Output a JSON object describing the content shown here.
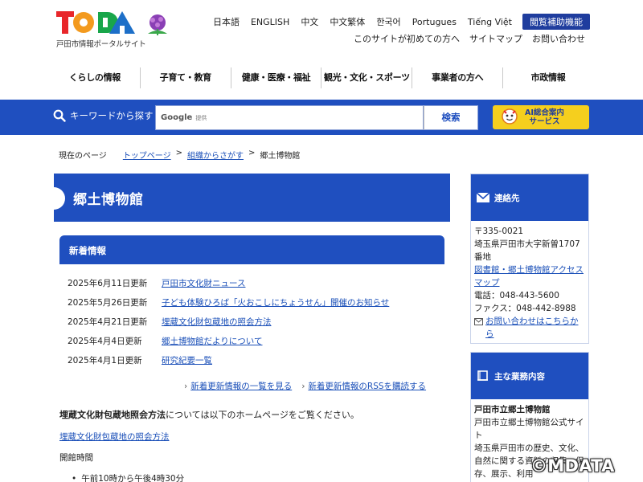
{
  "header": {
    "logo_text": "TODA",
    "logo_subtitle": "戸田市情報ポータルサイト",
    "languages": [
      "日本語",
      "ENGLISH",
      "中文",
      "中文繁体",
      "한국어",
      "Portugues",
      "Tiếng Việt"
    ],
    "assist_button": "閲覧補助機能",
    "util_links": [
      "このサイトが初めての方へ",
      "サイトマップ",
      "お問い合わせ"
    ],
    "global_nav": [
      "くらしの情報",
      "子育て・教育",
      "健康・医療・福祉",
      "観光・文化・スポーツ",
      "事業者の方へ",
      "市政情報"
    ]
  },
  "search": {
    "label": "キーワードから探す",
    "google_label": "Google",
    "google_sub": "提供",
    "button": "検索",
    "ai_line1": "AI総合案内",
    "ai_line2": "サービス"
  },
  "breadcrumb": {
    "label": "現在のページ",
    "links": [
      "トップページ",
      "組織からさがす"
    ],
    "current": "郷土博物館",
    "sep": ">"
  },
  "main": {
    "title": "郷土博物館",
    "news_heading": "新着情報",
    "news": [
      {
        "date": "2025年6月11日更新",
        "title": "戸田市文化財ニュース"
      },
      {
        "date": "2025年5月26日更新",
        "title": "子ども体験ひろば「火おこしにちょうせん」開催のお知らせ"
      },
      {
        "date": "2025年4月21日更新",
        "title": "埋蔵文化財包蔵地の照会方法"
      },
      {
        "date": "2025年4月4日更新",
        "title": "郷土博物館だよりについて"
      },
      {
        "date": "2025年4月1日更新",
        "title": "研究紀要一覧"
      }
    ],
    "more_links": [
      "新着更新情報の一覧を見る",
      "新着更新情報のRSSを購読する"
    ],
    "body_bold": "埋蔵文化財包蔵地照会方法",
    "body_rest": "については以下のホームページをご覧ください。",
    "body_link": "埋蔵文化財包蔵地の照会方法",
    "hours_label": "開館時間",
    "hours_bullet": "午前10時から午後4時30分"
  },
  "sidebar": {
    "contact_heading": "連絡先",
    "postal": "〒335-0021",
    "address": "埼玉県戸田市大字新曽1707番地",
    "access_link": "図書館・郷土博物館アクセスマップ",
    "phone": "電話：048-443-5600",
    "fax": "ファクス：048-442-8988",
    "inquiry_link": "お問い合わせはこちらから",
    "duties_heading": "主な業務内容",
    "duties_title": "戸田市立郷土博物館",
    "duties_line1": "戸田市立郷土博物館公式サイト",
    "duties_text": "埼玉県戸田市の歴史、文化、自然に関する資料の収集、保存、展示、利用"
  },
  "watermark": "©MDATA"
}
